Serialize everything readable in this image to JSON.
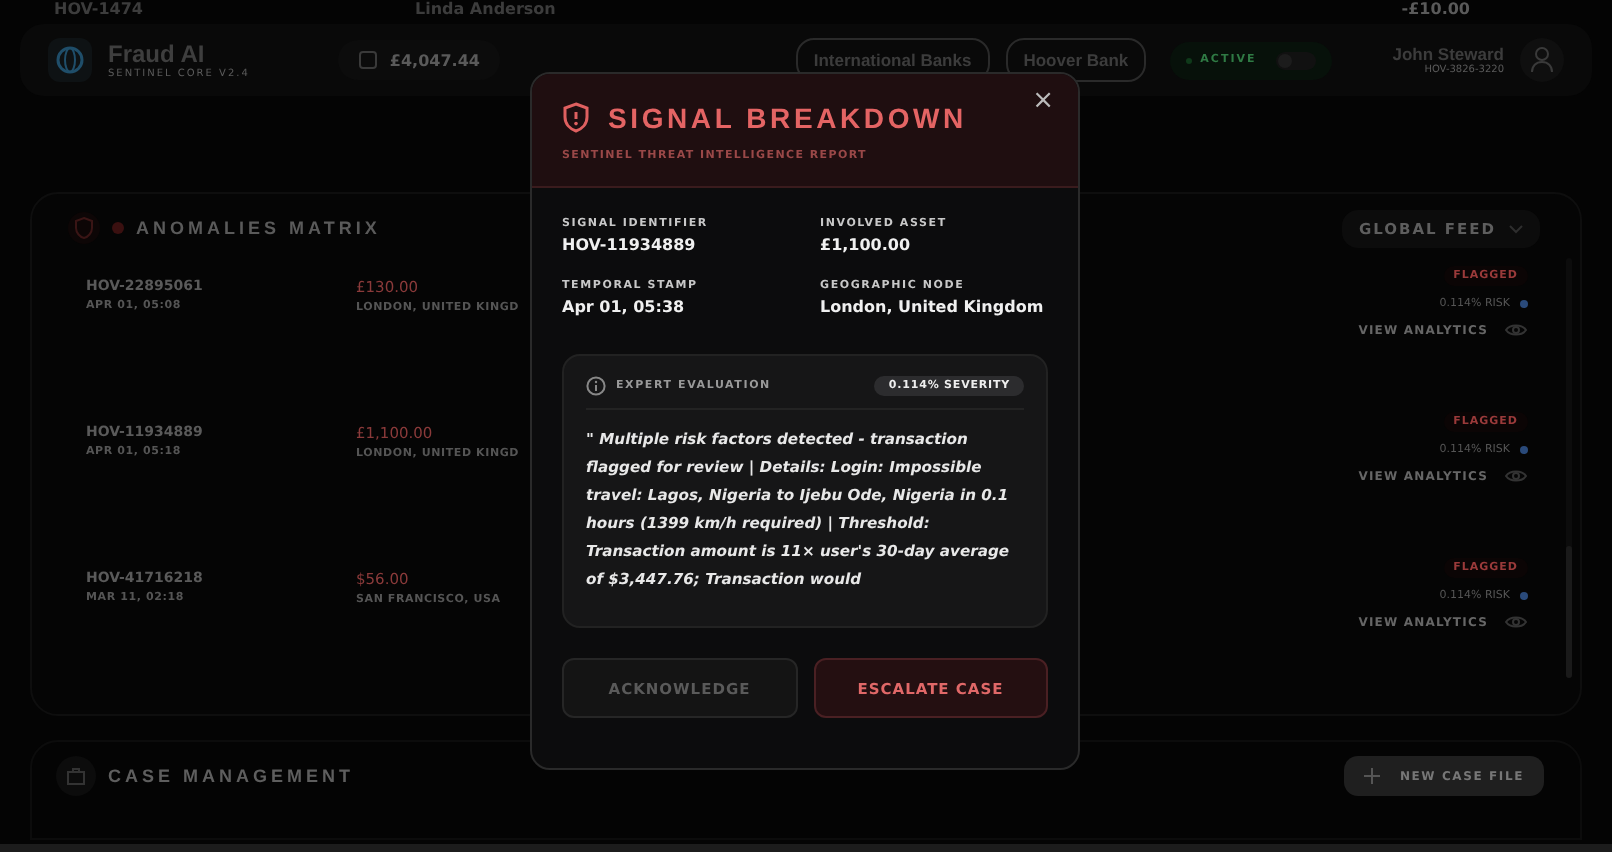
{
  "top_strip": {
    "left_id": "HOV-1474",
    "center_name": "Linda Anderson",
    "right_amount": "-£10.00"
  },
  "header": {
    "brand": "Fraud AI",
    "brand_sub": "SENTINEL CORE V2.4",
    "balance": "£4,047.44",
    "banks": [
      "International Banks",
      "Hoover Bank"
    ],
    "status": {
      "label": "ACTIVE",
      "on": false
    },
    "user": {
      "name": "John Steward",
      "id": "HOV-3826-3220"
    }
  },
  "anomalies": {
    "title": "ANOMALIES MATRIX",
    "filter": "GLOBAL FEED",
    "rows": [
      {
        "id": "HOV-22895061",
        "time": "APR 01, 05:08",
        "amount": "£130.00",
        "location": "LONDON, UNITED KINGD",
        "status": "FLAGGED",
        "risk": "0.114% RISK",
        "action": "VIEW ANALYTICS"
      },
      {
        "id": "HOV-11934889",
        "time": "APR 01, 05:18",
        "amount": "£1,100.00",
        "location": "LONDON, UNITED KINGD",
        "status": "FLAGGED",
        "risk": "0.114% RISK",
        "action": "VIEW ANALYTICS"
      },
      {
        "id": "HOV-41716218",
        "time": "MAR 11, 02:18",
        "amount": "$56.00",
        "location": "SAN FRANCISCO, USA",
        "status": "FLAGGED",
        "risk": "0.114% RISK",
        "action": "VIEW ANALYTICS"
      }
    ]
  },
  "case_management": {
    "title": "CASE MANAGEMENT",
    "new_button": "NEW CASE FILE"
  },
  "modal": {
    "title": "SIGNAL BREAKDOWN",
    "subtitle": "SENTINEL THREAT INTELLIGENCE REPORT",
    "close": "×",
    "fields": [
      {
        "label": "SIGNAL IDENTIFIER",
        "value": "HOV-11934889"
      },
      {
        "label": "INVOLVED ASSET",
        "value": "£1,100.00"
      },
      {
        "label": "TEMPORAL STAMP",
        "value": "Apr 01, 05:38"
      },
      {
        "label": "GEOGRAPHIC NODE",
        "value": "London, United Kingdom"
      }
    ],
    "evaluation": {
      "title": "EXPERT EVALUATION",
      "severity": "0.114% SEVERITY",
      "text": "\" Multiple risk factors detected - transaction flagged for review | Details: Login: Impossible travel: Lagos, Nigeria to Ijebu Ode, Nigeria in 0.1 hours (1399 km/h required) | Threshold: Transaction amount is 11× user's 30-day average of $3,447.76; Transaction would"
    },
    "buttons": [
      {
        "label": "ACKNOWLEDGE",
        "kind": "secondary",
        "disabled": true
      },
      {
        "label": "ESCALATE CASE",
        "kind": "primary",
        "disabled": false
      }
    ]
  }
}
